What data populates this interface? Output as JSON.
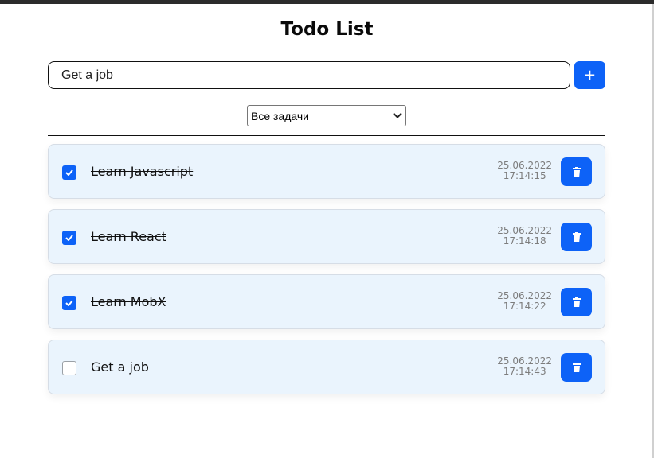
{
  "app": {
    "title": "Todo List"
  },
  "form": {
    "input_value": "Get a job",
    "add_button_label": "+"
  },
  "filter": {
    "selected": "Все задачи"
  },
  "todos": [
    {
      "text": "Learn Javascript",
      "completed": true,
      "date": "25.06.2022",
      "time": "17:14:15"
    },
    {
      "text": "Learn React",
      "completed": true,
      "date": "25.06.2022",
      "time": "17:14:18"
    },
    {
      "text": "Learn MobX",
      "completed": true,
      "date": "25.06.2022",
      "time": "17:14:22"
    },
    {
      "text": "Get a job",
      "completed": false,
      "date": "25.06.2022",
      "time": "17:14:43"
    }
  ],
  "icons": {
    "delete": "trash-icon",
    "check": "check-icon",
    "add": "plus-icon"
  },
  "colors": {
    "accent": "#0d62f7",
    "item_background": "#eaf4fd",
    "date_text": "#7d7d7d"
  }
}
